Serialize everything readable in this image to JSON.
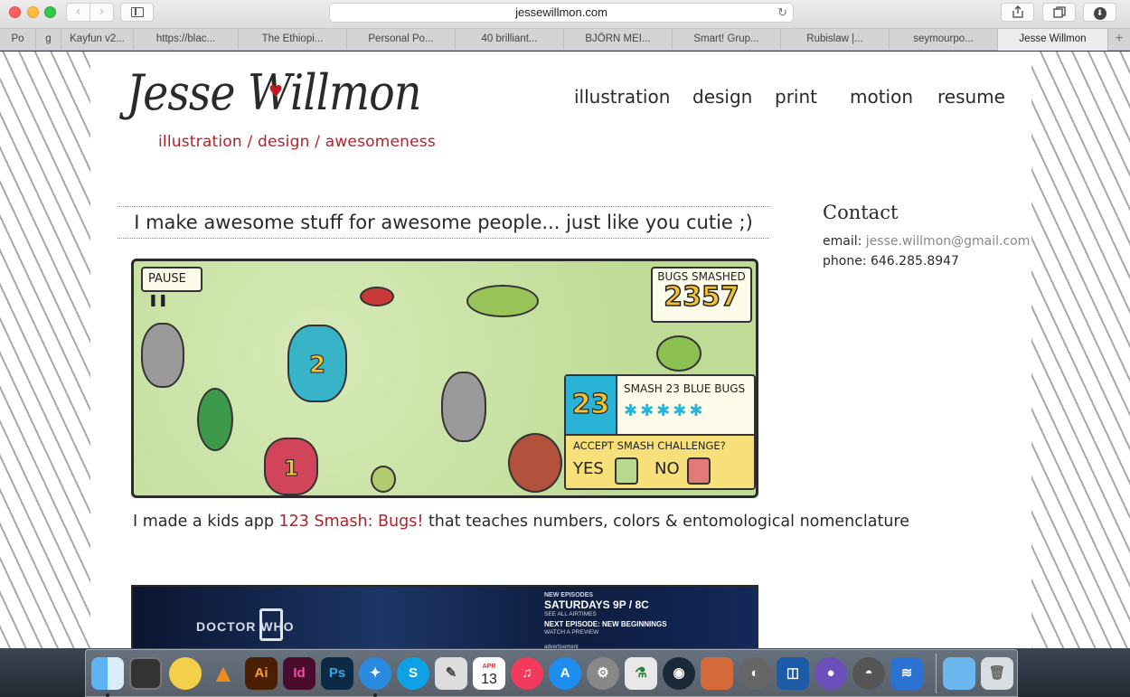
{
  "browser": {
    "url": "jessewillmon.com",
    "back_icon": "‹",
    "forward_icon": "›",
    "reload_icon": "↻",
    "tabs": [
      {
        "label": "Po"
      },
      {
        "label": "g"
      },
      {
        "label": "Kayfun v2..."
      },
      {
        "label": "https://blac..."
      },
      {
        "label": "The Ethiopi..."
      },
      {
        "label": "Personal Po..."
      },
      {
        "label": "40 brilliant..."
      },
      {
        "label": "BJÖRN MEI..."
      },
      {
        "label": "Smart! Grup..."
      },
      {
        "label": "Rubislaw |..."
      },
      {
        "label": "seymourpo..."
      },
      {
        "label": "Jesse Willmon"
      }
    ],
    "new_tab": "+"
  },
  "site": {
    "logo_name": "Jesse Willmon",
    "tagline": "illustration / design / awesomeness",
    "nav": [
      "illustration",
      "design",
      "print",
      "motion",
      "resume"
    ],
    "hero": "I make awesome stuff for awesome people... just like you cutie ;)",
    "game": {
      "pause": "PAUSE ❚❚",
      "score_label": "BUGS SMASHED",
      "score_value": "2357",
      "challenge_number": "23",
      "challenge_text": "SMASH 23 BLUE BUGS",
      "challenge_question": "ACCEPT SMASH CHALLENGE?",
      "yes": "YES",
      "no": "NO",
      "bug_labels": [
        "2",
        "1"
      ]
    },
    "caption": {
      "before": "I made a kids app ",
      "link": "123 Smash: Bugs!",
      "after": " that teaches numbers, colors & entomological nomenclature"
    },
    "doctor_who": {
      "logo": "DOCTOR WHO",
      "r1": "NEW EPISODES",
      "r2": "SATURDAYS 9P / 8C",
      "r3": "SEE ALL AIRTIMES",
      "r4": "NEXT EPISODE: NEW BEGINNINGS",
      "r5": "WATCH A PREVIEW",
      "r6": "advertisement"
    },
    "contact": {
      "heading": "Contact",
      "email_label": "email:",
      "email": "jesse.willmon@gmail.com",
      "phone_label": "phone:",
      "phone": "646.285.8947"
    }
  },
  "dock": {
    "calendar_month": "APR",
    "calendar_day": "13",
    "apps": [
      "finder-icon",
      "dashboard-icon",
      "cyberduck-icon",
      "vlc-icon",
      "illustrator-icon",
      "indesign-icon",
      "photoshop-icon",
      "safari-icon",
      "skype-icon",
      "script-editor-icon",
      "calendar-icon",
      "itunes-icon",
      "app-store-icon",
      "system-preferences-icon",
      "potion-icon",
      "steam-icon",
      "preview-icon",
      "growl-icon",
      "frame-icon",
      "github-icon",
      "sequel-pro-icon",
      "openoffice-icon",
      "downloads-folder-icon",
      "trash-icon"
    ]
  }
}
